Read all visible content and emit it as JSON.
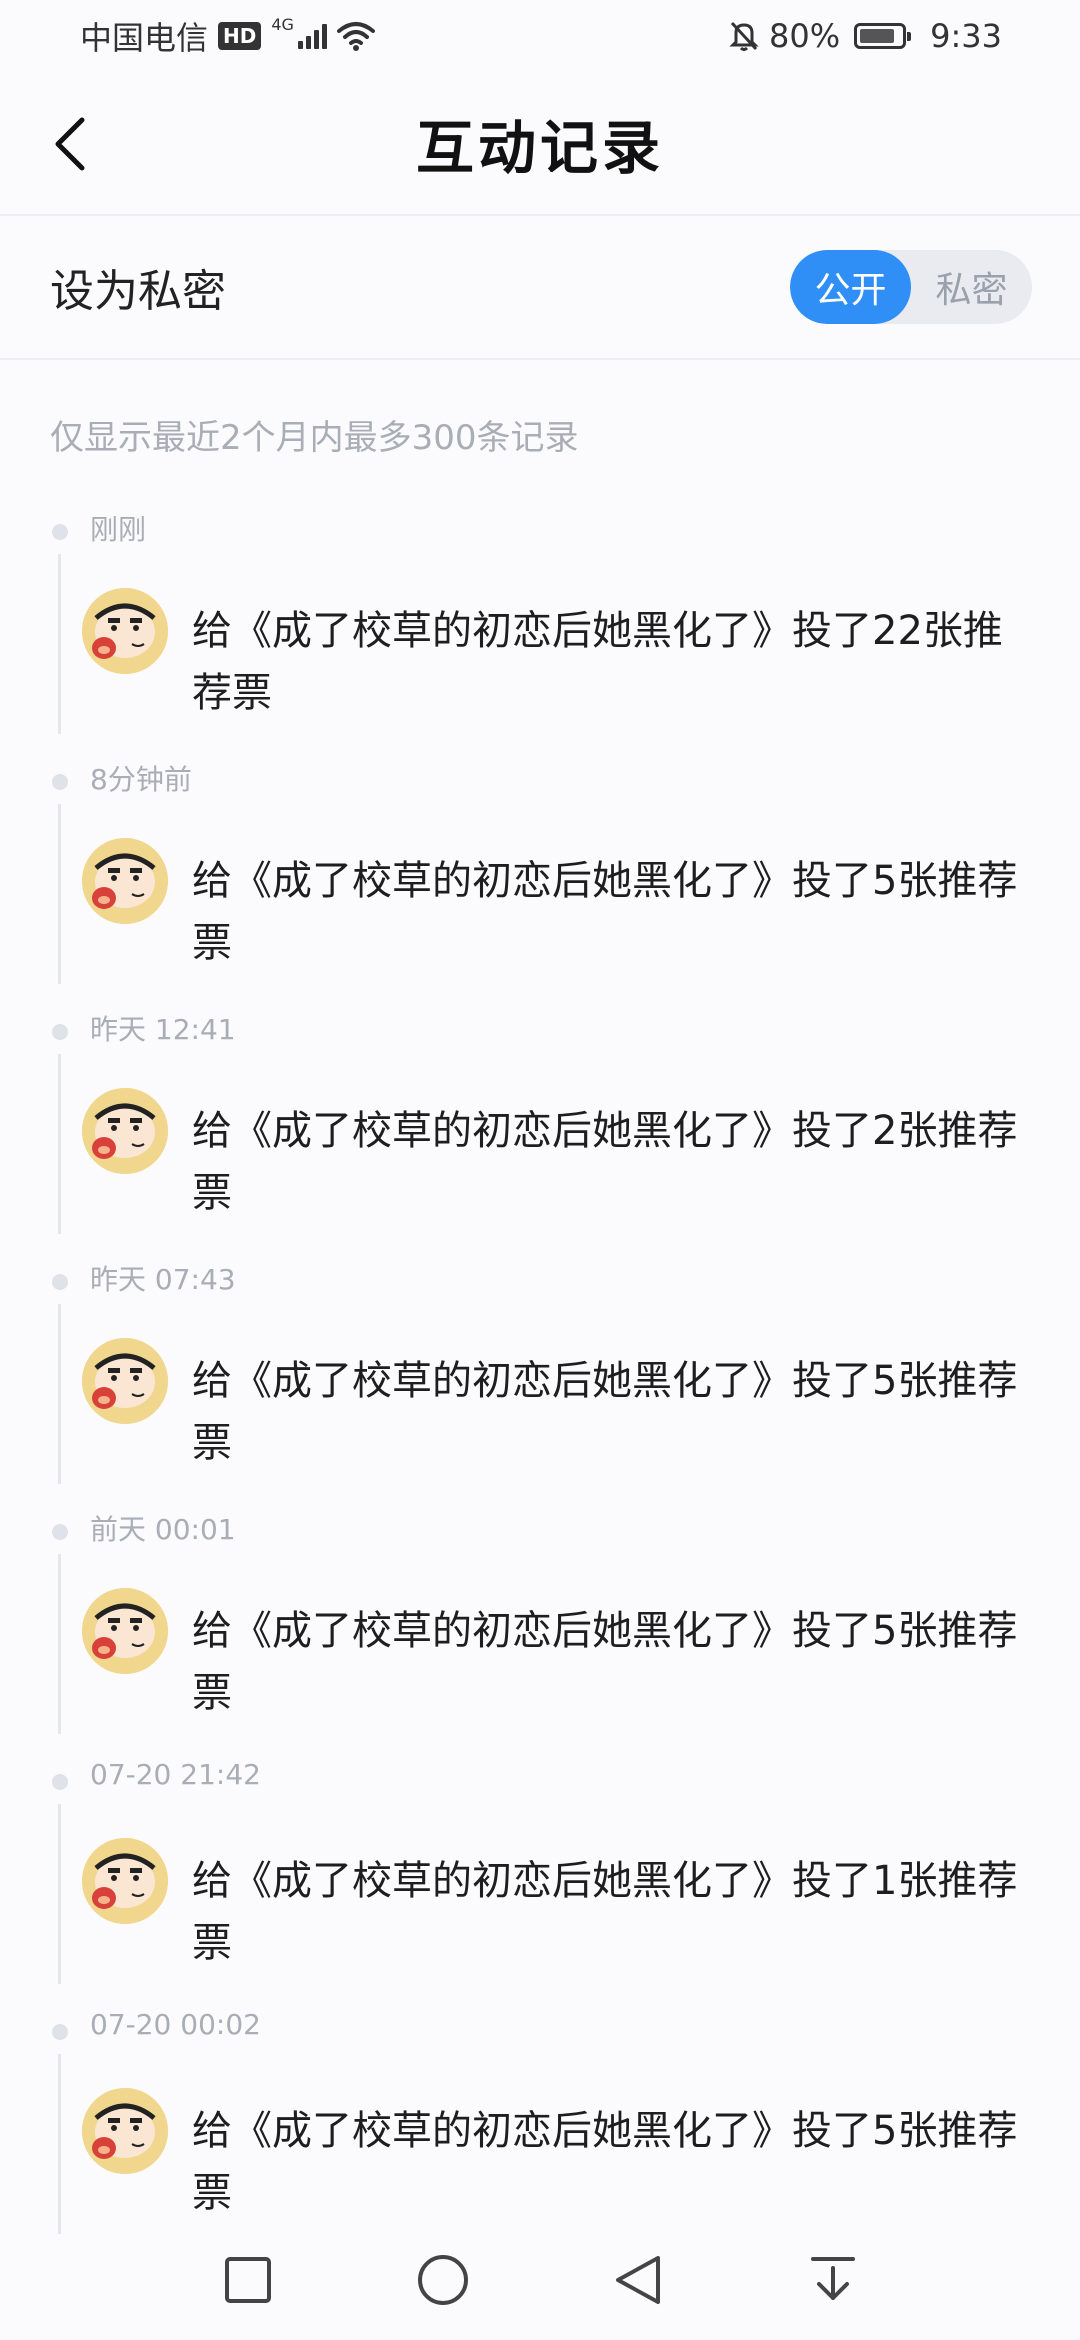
{
  "status_bar": {
    "carrier": "中国电信",
    "hd": "HD",
    "network": "4G",
    "battery": "80%",
    "time": "9:33"
  },
  "header": {
    "title": "互动记录",
    "back_icon": "chevron-left-icon"
  },
  "privacy": {
    "label": "设为私密",
    "options": [
      "公开",
      "私密"
    ],
    "selected": "公开",
    "active_color": "#2f8ff6"
  },
  "notice": "仅显示最近2个月内最多300条记录",
  "records": [
    {
      "time": "刚刚",
      "text": "给《成了校草的初恋后她黑化了》投了22张推荐票"
    },
    {
      "time": "8分钟前",
      "text": "给《成了校草的初恋后她黑化了》投了5张推荐票"
    },
    {
      "time": "昨天 12:41",
      "text": "给《成了校草的初恋后她黑化了》投了2张推荐票"
    },
    {
      "time": "昨天 07:43",
      "text": "给《成了校草的初恋后她黑化了》投了5张推荐票"
    },
    {
      "time": "前天 00:01",
      "text": "给《成了校草的初恋后她黑化了》投了5张推荐票"
    },
    {
      "time": "07-20 21:42",
      "text": "给《成了校草的初恋后她黑化了》投了1张推荐票"
    },
    {
      "time": "07-20 00:02",
      "text": "给《成了校草的初恋后她黑化了》投了5张推荐票"
    }
  ],
  "navbar": [
    "square-icon",
    "circle-home-icon",
    "triangle-back-icon",
    "notification-pull-icon"
  ]
}
